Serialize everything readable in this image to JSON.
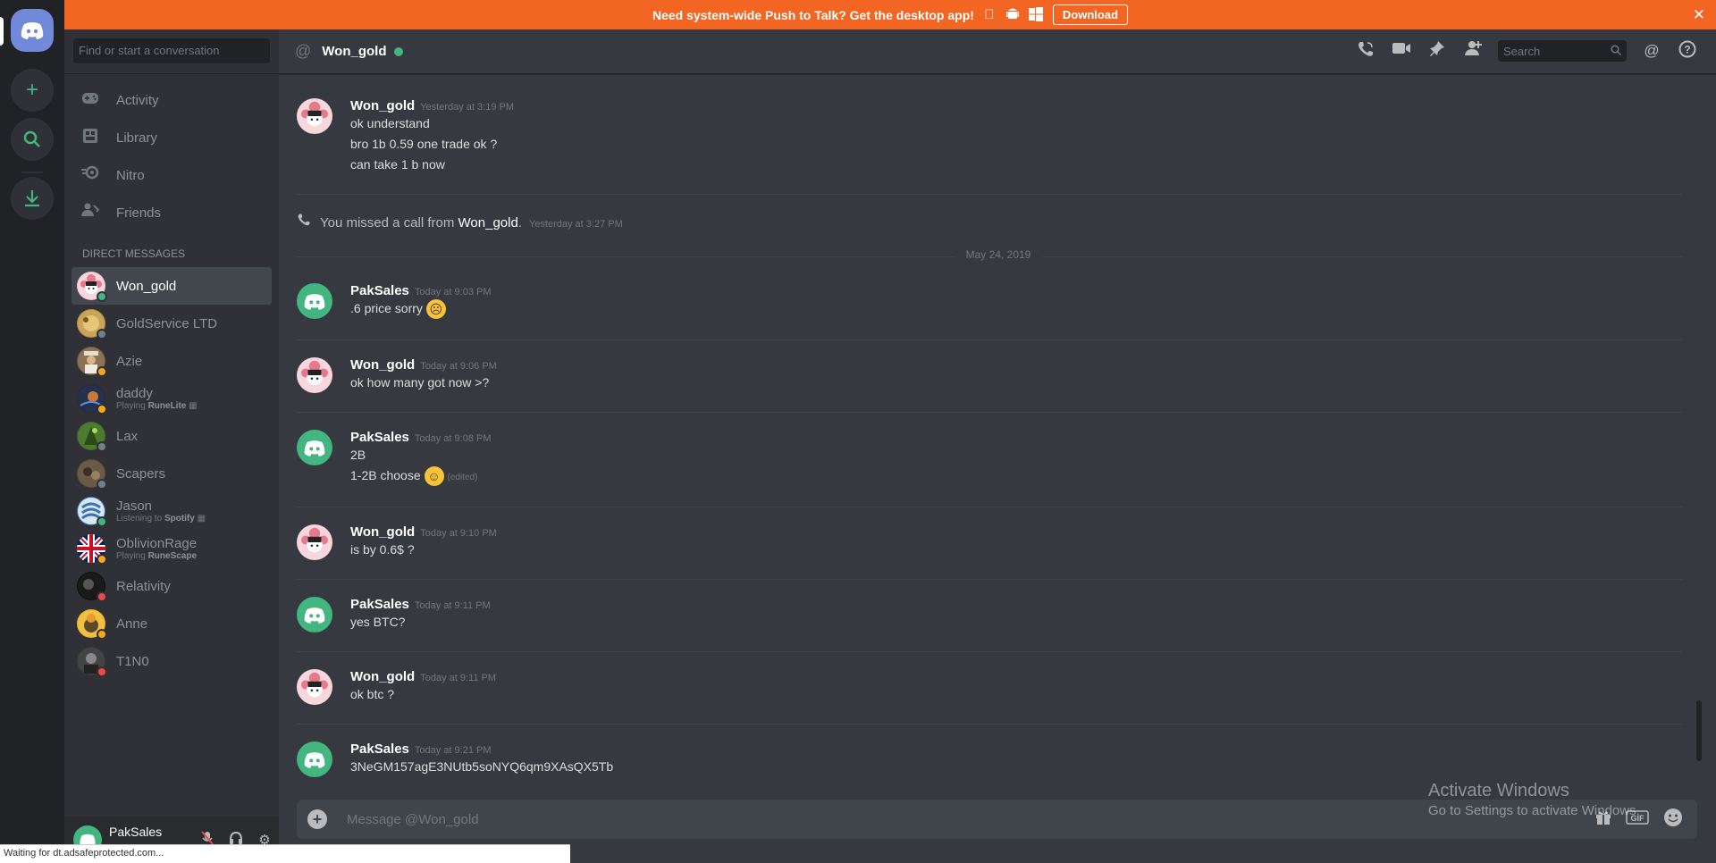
{
  "banner": {
    "text": "Need system-wide Push to Talk? Get the desktop app!",
    "download_label": "Download",
    "icons": [
      "apple-icon",
      "android-icon",
      "windows-icon"
    ]
  },
  "sidebar": {
    "search_placeholder": "Find or start a conversation",
    "nav": [
      {
        "label": "Activity",
        "icon": "gamepad-icon"
      },
      {
        "label": "Library",
        "icon": "library-icon"
      },
      {
        "label": "Nitro",
        "icon": "nitro-icon"
      },
      {
        "label": "Friends",
        "icon": "friends-icon"
      }
    ],
    "dm_header": "Direct Messages",
    "dms": [
      {
        "name": "Won_gold",
        "activity": "",
        "status": "online",
        "selected": true
      },
      {
        "name": "GoldService LTD",
        "activity": "",
        "status": "offline"
      },
      {
        "name": "Azie",
        "activity": "",
        "status": "idle"
      },
      {
        "name": "daddy",
        "activity_prefix": "Playing ",
        "activity": "RuneLite",
        "status": "idle"
      },
      {
        "name": "Lax",
        "activity": "",
        "status": "offline"
      },
      {
        "name": "Scapers",
        "activity": "",
        "status": "offline"
      },
      {
        "name": "Jason",
        "activity_prefix": "Listening to ",
        "activity": "Spotify",
        "status": "online"
      },
      {
        "name": "OblivionRage",
        "activity_prefix": "Playing ",
        "activity": "RuneScape",
        "status": "idle"
      },
      {
        "name": "Relativity",
        "activity": "",
        "status": "dnd"
      },
      {
        "name": "Anne",
        "activity": "",
        "status": "idle"
      },
      {
        "name": "T1N0",
        "activity": "",
        "status": "dnd"
      }
    ],
    "user": {
      "name": "PakSales"
    }
  },
  "header": {
    "channel": "Won_gold",
    "search_placeholder": "Search"
  },
  "messages": {
    "group1": {
      "author": "Won_gold",
      "time": "Yesterday at 3:19 PM",
      "lines": [
        "ok understand",
        "bro 1b 0.59 one  trade ok ?",
        "can  take 1 b now"
      ]
    },
    "missed_call": {
      "prefix": "You missed a call from ",
      "name": "Won_gold",
      "suffix": ".",
      "time": "Yesterday at 3:27 PM"
    },
    "date": "May 24, 2019",
    "m1": {
      "author": "PakSales",
      "time": "Today at 9:03 PM",
      "line": ".6 price sorry"
    },
    "m2": {
      "author": "Won_gold",
      "time": "Today at 9:06 PM",
      "line": "ok how many got now >?"
    },
    "m3": {
      "author": "PakSales",
      "time": "Today at 9:08 PM",
      "line1": "2B",
      "line2": "1-2B choose",
      "edited": "(edited)"
    },
    "m4": {
      "author": "Won_gold",
      "time": "Today at 9:10 PM",
      "line": "is by 0.6$ ?"
    },
    "m5": {
      "author": "PakSales",
      "time": "Today at 9:11 PM",
      "line": "yes BTC?"
    },
    "m6": {
      "author": "Won_gold",
      "time": "Today at 9:11 PM",
      "line": "ok btc ?"
    },
    "m7": {
      "author": "PakSales",
      "time": "Today at 9:21 PM",
      "line": "3NeGM157agE3NUtb5soNYQ6qm9XAsQX5Tb"
    }
  },
  "composer": {
    "placeholder": "Message @Won_gold"
  },
  "watermark": {
    "line1": "Activate Windows",
    "line2": "Go to Settings to activate Windows."
  },
  "browser_status": "Waiting for dt.adsafeprotected.com...",
  "colors": {
    "accent": "#7289da",
    "banner": "#f26522",
    "online": "#43b581",
    "idle": "#faa61a",
    "dnd": "#f04747",
    "offline": "#747f8d"
  }
}
